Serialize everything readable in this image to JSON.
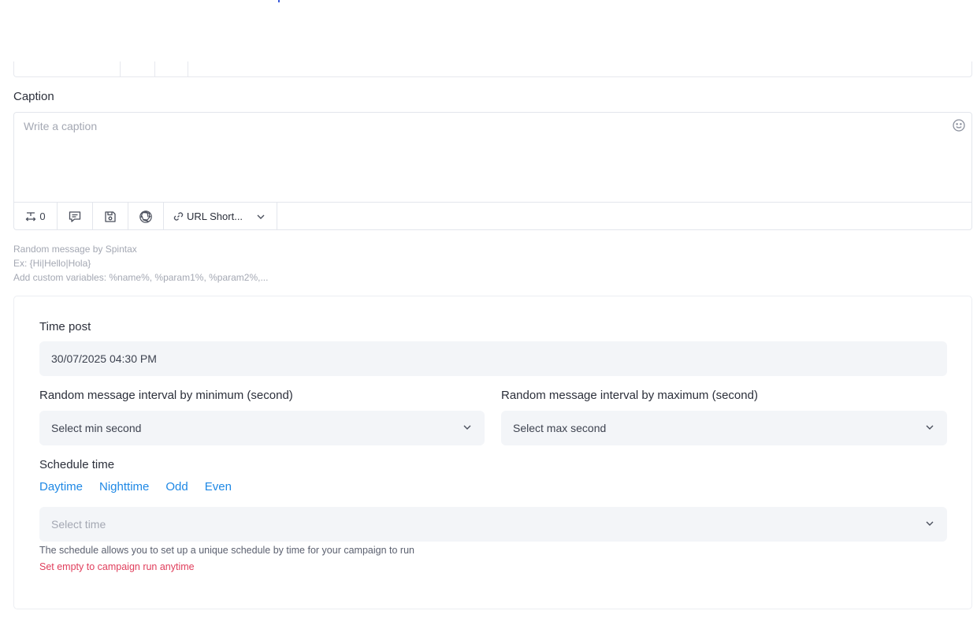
{
  "caption": {
    "label": "Caption",
    "placeholder": "Write a caption",
    "toolbar": {
      "count": "0",
      "url_shortener_label": "URL Short..."
    }
  },
  "hints": {
    "line1": "Random message by Spintax",
    "line2": "Ex: {Hi|Hello|Hola}",
    "line3": "Add custom variables: %name%, %param1%, %param2%,..."
  },
  "time_post": {
    "label": "Time post",
    "value": "30/07/2025 04:30 PM"
  },
  "interval": {
    "min_label": "Random message interval by minimum (second)",
    "min_placeholder": "Select min second",
    "max_label": "Random message interval by maximum (second)",
    "max_placeholder": "Select max second"
  },
  "schedule": {
    "label": "Schedule time",
    "presets": [
      "Daytime",
      "Nighttime",
      "Odd",
      "Even"
    ],
    "select_placeholder": "Select time",
    "description": "The schedule allows you to set up a unique schedule by time for your campaign to run",
    "warning": "Set empty to campaign run anytime"
  },
  "colors": {
    "link": "#1e88e5",
    "warning": "#e03e5c",
    "field_bg": "#f3f5f8"
  }
}
